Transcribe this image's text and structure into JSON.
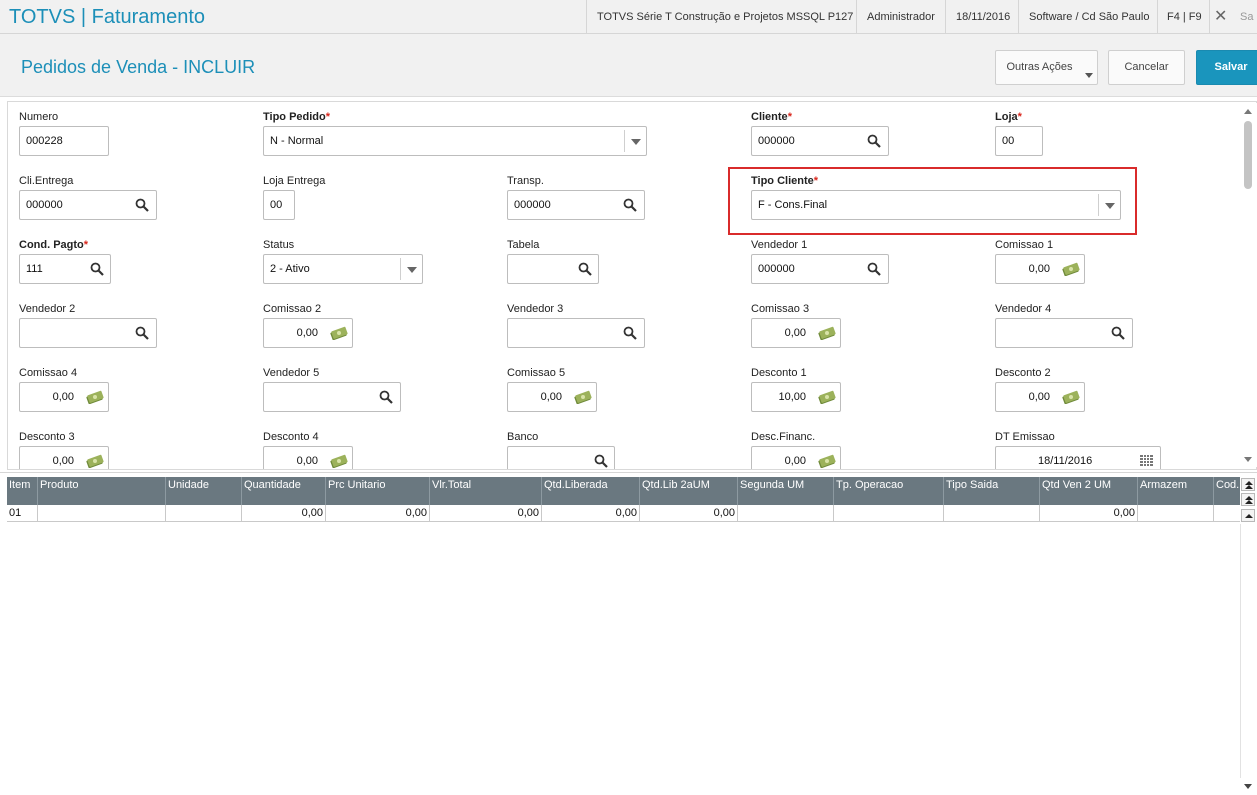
{
  "app": {
    "title": "TOTVS | Faturamento",
    "close_label": "Sa"
  },
  "topbar": {
    "environment": "TOTVS Série T Construção e Projetos MSSQL P127",
    "user": "Administrador",
    "date": "18/11/2016",
    "company": "Software / Cd São Paulo",
    "shortcuts": "F4 | F9"
  },
  "header": {
    "title": "Pedidos de Venda - INCLUIR",
    "btn_outras": "Outras Ações",
    "btn_cancelar": "Cancelar",
    "btn_salvar": "Salvar"
  },
  "colors": {
    "accent": "#1c8fb8",
    "required": "#d9261c",
    "highlight": "#d92b2b",
    "grid_header": "#6a7880"
  },
  "form": {
    "numero": {
      "label": "Numero",
      "value": "000228"
    },
    "tipo_pedido": {
      "label": "Tipo Pedido",
      "value": "N - Normal"
    },
    "cliente": {
      "label": "Cliente",
      "value": "000000"
    },
    "loja": {
      "label": "Loja",
      "value": "00"
    },
    "cli_entrega": {
      "label": "Cli.Entrega",
      "value": "000000"
    },
    "loja_entrega": {
      "label": "Loja Entrega",
      "value": "00"
    },
    "transp": {
      "label": "Transp.",
      "value": "000000"
    },
    "tipo_cliente": {
      "label": "Tipo Cliente",
      "value": "F - Cons.Final"
    },
    "cond_pagto": {
      "label": "Cond. Pagto",
      "value": "111"
    },
    "status": {
      "label": "Status",
      "value": "2 - Ativo"
    },
    "tabela": {
      "label": "Tabela",
      "value": ""
    },
    "vendedor1": {
      "label": "Vendedor 1",
      "value": "000000"
    },
    "comissao1": {
      "label": "Comissao 1",
      "value": "0,00"
    },
    "vendedor2": {
      "label": "Vendedor 2",
      "value": ""
    },
    "comissao2": {
      "label": "Comissao 2",
      "value": "0,00"
    },
    "vendedor3": {
      "label": "Vendedor 3",
      "value": ""
    },
    "comissao3": {
      "label": "Comissao 3",
      "value": "0,00"
    },
    "vendedor4": {
      "label": "Vendedor 4",
      "value": ""
    },
    "comissao4": {
      "label": "Comissao 4",
      "value": "0,00"
    },
    "vendedor5": {
      "label": "Vendedor 5",
      "value": ""
    },
    "comissao5": {
      "label": "Comissao 5",
      "value": "0,00"
    },
    "desconto1": {
      "label": "Desconto 1",
      "value": "10,00"
    },
    "desconto2": {
      "label": "Desconto 2",
      "value": "0,00"
    },
    "desconto3": {
      "label": "Desconto 3",
      "value": "0,00"
    },
    "desconto4": {
      "label": "Desconto 4",
      "value": "0,00"
    },
    "banco": {
      "label": "Banco",
      "value": ""
    },
    "desc_financ": {
      "label": "Desc.Financ.",
      "value": "0,00"
    },
    "dt_emissao": {
      "label": "DT Emissao",
      "value": "18/11/2016"
    }
  },
  "grid": {
    "columns": [
      "Item",
      "Produto",
      "Unidade",
      "Quantidade",
      "Prc Unitario",
      "Vlr.Total",
      "Qtd.Liberada",
      "Qtd.Lib 2aUM",
      "Segunda UM",
      "Tp. Operacao",
      "Tipo Saida",
      "Qtd Ven 2 UM",
      "Armazem",
      "Cod."
    ],
    "rows": [
      [
        "01",
        "",
        "",
        "0,00",
        "0,00",
        "0,00",
        "0,00",
        "0,00",
        "",
        "",
        "",
        "0,00",
        "",
        ""
      ]
    ]
  }
}
